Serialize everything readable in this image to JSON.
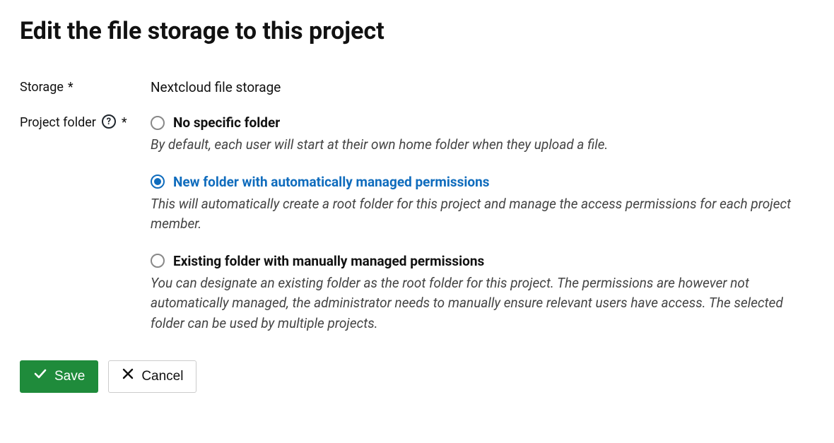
{
  "page_title": "Edit the file storage to this project",
  "form": {
    "storage": {
      "label": "Storage",
      "required_mark": "*",
      "value": "Nextcloud file storage"
    },
    "project_folder": {
      "label": "Project folder",
      "required_mark": "*",
      "options": [
        {
          "label": "No specific folder",
          "description": "By default, each user will start at their own home folder when they upload a file.",
          "selected": false
        },
        {
          "label": "New folder with automatically managed permissions",
          "description": "This will automatically create a root folder for this project and manage the access permissions for each project member.",
          "selected": true
        },
        {
          "label": "Existing folder with manually managed permissions",
          "description": "You can designate an existing folder as the root folder for this project. The permissions are however not automatically managed, the administrator needs to manually ensure relevant users have access. The selected folder can be used by multiple projects.",
          "selected": false
        }
      ]
    }
  },
  "actions": {
    "save_label": "Save",
    "cancel_label": "Cancel"
  }
}
